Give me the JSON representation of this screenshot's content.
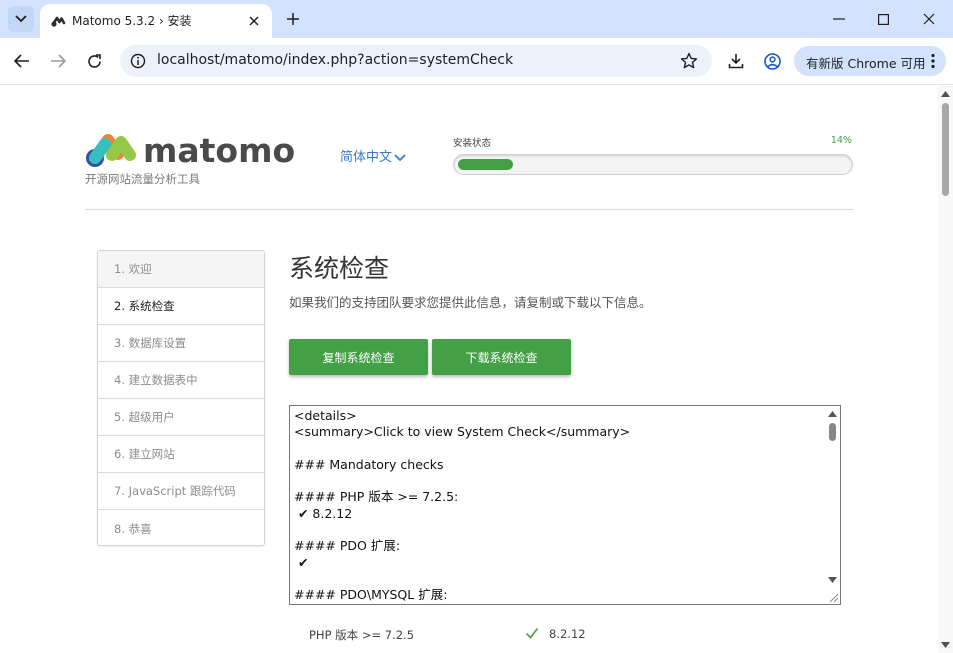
{
  "browser": {
    "tab_title": "Matomo 5.3.2 › 安装",
    "url": "localhost/matomo/index.php?action=systemCheck",
    "update_button_label": "有新版 Chrome 可用",
    "icons": [
      "tab-search-icon",
      "matomo-favicon-icon",
      "close-icon",
      "plus-icon",
      "minimize-icon",
      "maximize-icon",
      "window-close-icon",
      "back-arrow-icon",
      "forward-arrow-icon",
      "reload-icon",
      "site-info-icon",
      "bookmark-star-icon",
      "download-icon",
      "profile-icon",
      "more-vertical-icon"
    ]
  },
  "header": {
    "brand_name": "matomo",
    "tagline": "开源网站流量分析工具",
    "language": "简体中文",
    "progress_label": "安装状态",
    "progress_percent_text": "14%",
    "progress_value": 0.14
  },
  "steps": [
    {
      "label": "1. 欢迎"
    },
    {
      "label": "2. 系统检查"
    },
    {
      "label": "3. 数据库设置"
    },
    {
      "label": "4. 建立数据表中"
    },
    {
      "label": "5. 超级用户"
    },
    {
      "label": "6. 建立网站"
    },
    {
      "label": "7. JavaScript 跟踪代码"
    },
    {
      "label": "8. 恭喜"
    }
  ],
  "current_step": "2. 系统检查",
  "main": {
    "title": "系统检查",
    "description": "如果我们的支持团队要求您提供此信息，请复制或下载以下信息。",
    "copy_button": "复制系统检查",
    "download_button": "下载系统检查",
    "report_text": "<details>\n<summary>Click to view System Check</summary>\n\n### Mandatory checks\n\n#### PHP 版本 >= 7.2.5:\n ✔ 8.2.12\n\n#### PDO 扩展:\n ✔\n\n#### PDO\\MYSQL 扩展:"
  },
  "requirements": [
    {
      "name": "PHP 版本 >= 7.2.5",
      "status": "ok",
      "value": "8.2.12"
    }
  ],
  "colors": {
    "accent_green": "#43a047",
    "link_blue": "#3d78c6",
    "chrome_tab_bar": "#d3e3fd"
  }
}
